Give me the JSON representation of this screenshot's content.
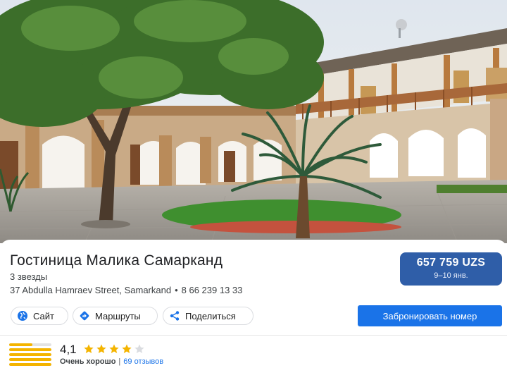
{
  "hotel": {
    "name": "Гостиница Малика Самарканд",
    "class": "3 звезды",
    "address": "37 Abdulla Hamraev Street, Samarkand",
    "separator": "•",
    "phone": "8 66 239 13 33"
  },
  "price": {
    "amount": "657 759 UZS",
    "dates": "9–10 янв."
  },
  "actions": {
    "website_label": "Сайт",
    "directions_label": "Маршруты",
    "share_label": "Поделиться",
    "book_label": "Забронировать номер"
  },
  "icons": {
    "website": "globe-icon",
    "directions": "directions-icon",
    "share": "share-icon"
  },
  "rating": {
    "score": "4,1",
    "stars_filled": 4,
    "stars_total": 5,
    "quality": "Очень хорошо",
    "separator": "|",
    "reviews": "69 отзывов",
    "distribution": [
      0.55,
      1.0,
      1.0,
      1.0,
      1.0
    ]
  },
  "colors": {
    "price_bg": "#2f5ea8",
    "button_blue": "#1a73e8",
    "star_gold": "#f4b400",
    "link_blue": "#1a73e8"
  }
}
